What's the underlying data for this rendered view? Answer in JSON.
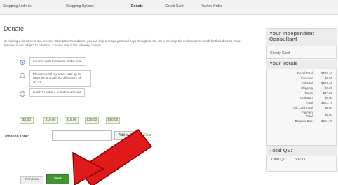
{
  "steps": [
    {
      "label": "Shopping Address"
    },
    {
      "label": "Shopping Options"
    },
    {
      "label": "Donate"
    },
    {
      "label": "Credit Card"
    },
    {
      "label": "Review Order"
    }
  ],
  "step_separator": "→",
  "page_title": "Donate",
  "intro": "By making a donation to the Arbonne Charitable Foundation, you can help teenage girls and boys throughout the US to develop the confidence to reach for their dreams. Your donation is not subject to sales tax. Choose one of the following options.",
  "options": {
    "no_donate": "I do not wish to donate at this time.",
    "round_up": "Please round my order total up to $622.00. Donate the difference of $0.21.",
    "enter_amount": "I wish to enter a donation amount."
  },
  "amounts": [
    "$5.00",
    "$10.00",
    "$15.00",
    "$25.00",
    "$50.00"
  ],
  "donation_total_label": "Donation Total:",
  "add_to_bag": "Add to Bag",
  "clear": "Clear",
  "buttons": {
    "previous": "Previous",
    "next": "Next"
  },
  "sidebar": {
    "consultant_heading": "Your Independent Consultant",
    "consultant_name": "Christy Card",
    "totals_heading": "Your Totals",
    "totals": [
      {
        "label": "Retail Total:",
        "value": "$574.40"
      },
      {
        "label": "Discount:",
        "value": "$0.00"
      },
      {
        "label": "Subtotal:",
        "value": "$574.40"
      },
      {
        "label": "Shipping:",
        "value": "$0.00"
      },
      {
        "label": "Taxes:",
        "value": "$47.39"
      },
      {
        "label": "Donation:",
        "value": "$0.00"
      },
      {
        "label": "Total:",
        "value": "$621.79"
      },
      {
        "label": "Gift Card Total:",
        "value": "$0.00"
      },
      {
        "label": "Payment Total:",
        "value": "$0.00"
      },
      {
        "label": "Balance Due:",
        "value": "$621.79"
      }
    ],
    "qv_heading": "Total QV:",
    "qv_label": "Total QV:",
    "qv_value": "557.00"
  },
  "colors": {
    "accent_green": "#3f962f",
    "arrow_red": "#e01a1a"
  }
}
